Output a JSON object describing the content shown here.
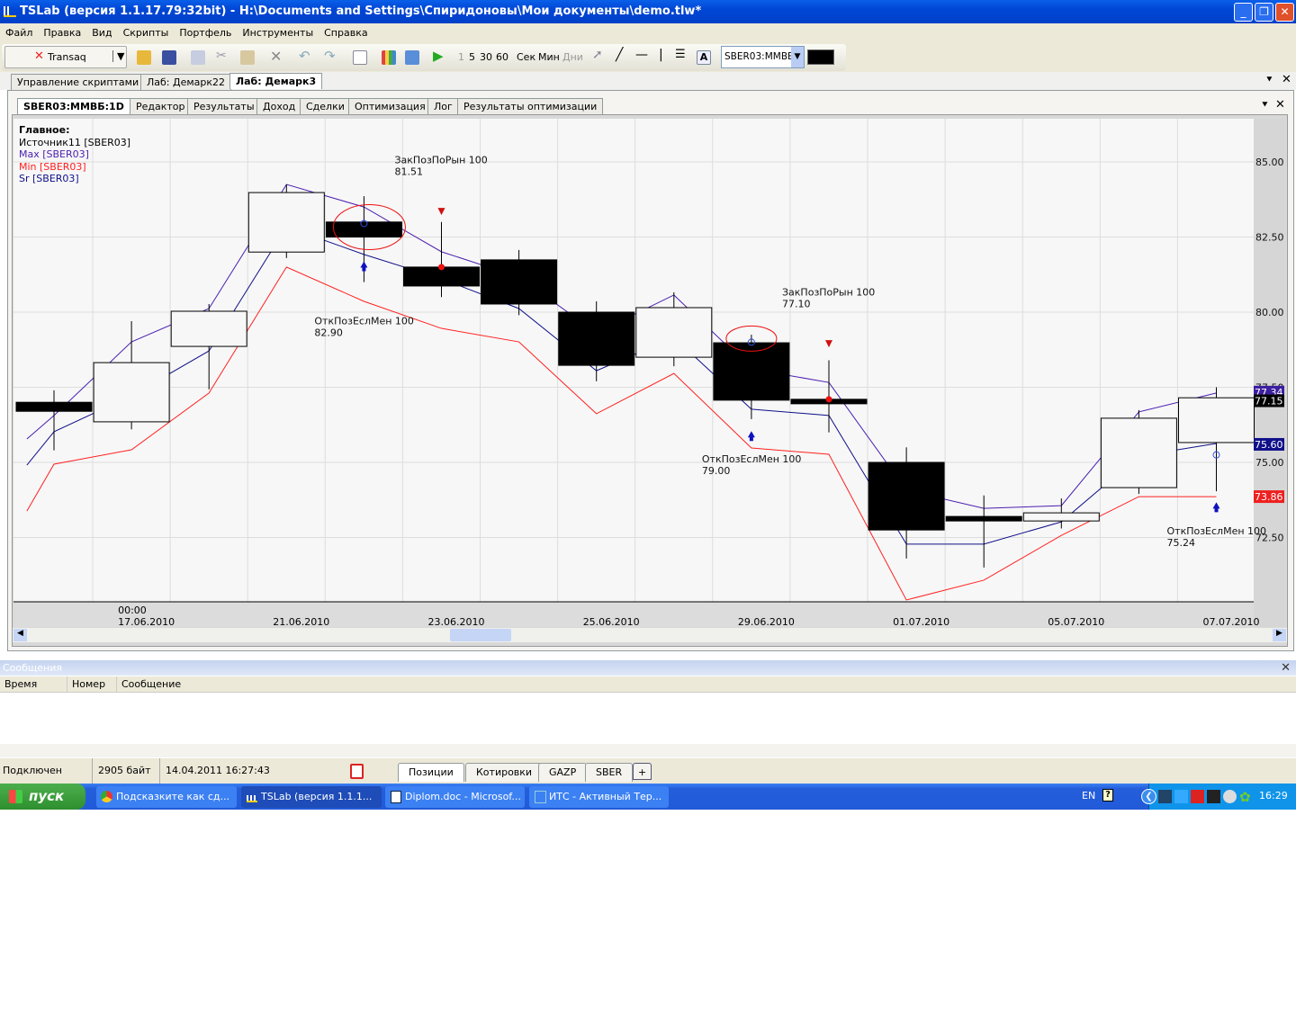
{
  "window": {
    "title": "TSLab (версия 1.1.17.79:32bit) - H:\\Documents and Settings\\Спиридоновы\\Мои документы\\demo.tlw*"
  },
  "menu": [
    "Файл",
    "Правка",
    "Вид",
    "Скрипты",
    "Портфель",
    "Инструменты",
    "Справка"
  ],
  "toolbar": {
    "connector": "Transaq",
    "intervals": [
      "1",
      "5",
      "30",
      "60"
    ],
    "units": [
      "Сек",
      "Мин",
      "Дни"
    ],
    "symbol": "SBER03:ММВБ"
  },
  "doc_tabs": [
    "Управление скриптами",
    "Лаб: Демарк22",
    "Лаб: Демарк3"
  ],
  "inner_tabs": [
    "SBER03:ММВБ:1D",
    "Редактор",
    "Результаты",
    "Доход",
    "Сделки",
    "Оптимизация",
    "Лог",
    "Результаты оптимизации"
  ],
  "chart_data": {
    "type": "candlestick",
    "legend": {
      "title": "Главное:",
      "items": [
        {
          "name": "Источник11 [SBER03]",
          "color": "#000000"
        },
        {
          "name": "Max [SBER03]",
          "color": "#4a1fb0"
        },
        {
          "name": "Min [SBER03]",
          "color": "#ff2020"
        },
        {
          "name": "Sr [SBER03]",
          "color": "#10108a"
        }
      ]
    },
    "ylim": [
      70.5,
      86.5
    ],
    "yticks": [
      85.0,
      82.5,
      80.0,
      77.5,
      75.0,
      72.5
    ],
    "ytick_labels": [
      "85.00",
      "82.50",
      "80.00",
      "77.50",
      "75.00",
      "72.50"
    ],
    "xlabels": [
      {
        "i": 1,
        "t": "00:00",
        "d": "17.06.2010"
      },
      {
        "i": 3,
        "d": "21.06.2010"
      },
      {
        "i": 5,
        "d": "23.06.2010"
      },
      {
        "i": 7,
        "d": "25.06.2010"
      },
      {
        "i": 9,
        "d": "29.06.2010"
      },
      {
        "i": 11,
        "d": "01.07.2010"
      },
      {
        "i": 13,
        "d": "05.07.2010"
      },
      {
        "i": 15,
        "d": "07.07.2010"
      }
    ],
    "candles": [
      [
        77.0,
        77.4,
        75.4,
        76.7
      ],
      [
        76.35,
        79.7,
        76.1,
        78.32
      ],
      [
        78.86,
        80.27,
        77.43,
        80.03
      ],
      [
        82.0,
        84.25,
        81.8,
        83.98
      ],
      [
        83.0,
        83.86,
        81.0,
        82.5
      ],
      [
        81.5,
        83.0,
        80.5,
        80.87
      ],
      [
        81.74,
        82.07,
        79.9,
        80.27
      ],
      [
        80.0,
        80.36,
        77.7,
        78.23
      ],
      [
        78.5,
        80.66,
        78.2,
        80.15
      ],
      [
        78.98,
        79.25,
        76.44,
        77.07
      ],
      [
        77.1,
        78.4,
        76.0,
        76.95
      ],
      [
        75.0,
        75.5,
        71.8,
        72.75
      ],
      [
        73.2,
        73.9,
        71.5,
        73.05
      ],
      [
        73.05,
        73.8,
        72.8,
        73.32
      ],
      [
        74.16,
        76.74,
        73.95,
        76.47
      ],
      [
        75.66,
        77.5,
        74.04,
        77.15
      ]
    ],
    "series": [
      {
        "name": "Max",
        "color": "#4a1fb0",
        "start": 75.78,
        "values": [
          76.56,
          79.01,
          80.12,
          84.25,
          83.5,
          82.01,
          81.17,
          79.31,
          80.57,
          78.11,
          77.66,
          74.07,
          73.47,
          73.56,
          76.68,
          77.31
        ]
      },
      {
        "name": "Sr",
        "color": "#10108a",
        "start": 74.91,
        "values": [
          76.02,
          77.22,
          78.71,
          82.84,
          81.92,
          81.11,
          80.12,
          78.05,
          79.16,
          76.77,
          76.56,
          72.28,
          72.28,
          73.02,
          75.21,
          75.63
        ]
      },
      {
        "name": "Min",
        "color": "#ff2020",
        "start": 73.38,
        "values": [
          74.94,
          75.42,
          77.31,
          81.5,
          80.36,
          79.46,
          79.01,
          76.62,
          77.96,
          75.48,
          75.27,
          70.42,
          71.08,
          72.57,
          73.86,
          73.86
        ]
      }
    ],
    "badges": [
      {
        "t": "77.34",
        "v": 77.34,
        "bg": "#3c1e9e"
      },
      {
        "t": "77.15",
        "v": 77.05,
        "bg": "#000000"
      },
      {
        "t": "75.60",
        "v": 75.6,
        "bg": "#10108a"
      },
      {
        "t": "73.86",
        "v": 73.86,
        "bg": "#ee2020"
      }
    ],
    "signals": [
      {
        "type": "buy",
        "i": 4,
        "v": 81.6,
        "circle": 82.95,
        "label": "ОткПозЕслМен 100",
        "price": "82.90",
        "lv": 79.6
      },
      {
        "type": "sell",
        "i": 5,
        "v": 83.35,
        "dot": 81.5,
        "label": "ЗакПозПоРын 100",
        "price": "81.51",
        "lv": 84.95
      },
      {
        "type": "buy",
        "i": 9,
        "v": 75.95,
        "circle": 79.0,
        "label": "ОткПозЕслМен 100",
        "price": "79.00",
        "lv": 75.0
      },
      {
        "type": "sell",
        "i": 10,
        "v": 78.95,
        "dot": 77.1,
        "label": "ЗакПозПоРын 100",
        "price": "77.10",
        "lv": 80.55
      },
      {
        "type": "buy",
        "i": 15,
        "v": 73.58,
        "circle": 75.25,
        "label": "ОткПозЕслМен 100",
        "price": "75.24",
        "lv": 72.6
      }
    ]
  },
  "messages": {
    "title": "Сообщения",
    "columns": [
      "Время",
      "Номер",
      "Сообщение"
    ]
  },
  "status": {
    "state": "Подключен",
    "bytes": "2905 байт",
    "datetime": "14.04.2011 16:27:43"
  },
  "bottom_tabs": [
    "Позиции",
    "Котировки",
    "GAZP",
    "SBER",
    "+"
  ],
  "taskbar": {
    "start": "пуск",
    "tasks": [
      "Подсказките как сд...",
      "TSLab (версия 1.1.1...",
      "Diplom.doc - Microsof...",
      "ИТС - Активный Тер..."
    ],
    "lang": "EN",
    "clock": "16:29"
  }
}
